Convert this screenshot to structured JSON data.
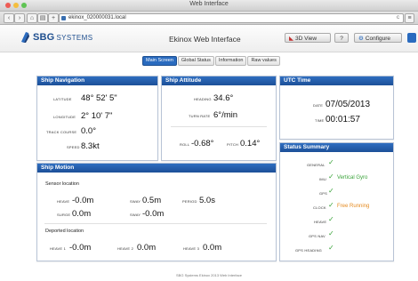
{
  "window": {
    "title": "Web Interface"
  },
  "browser": {
    "url": "ekinox_020000031.local",
    "reload": "c"
  },
  "header": {
    "brand": "SBG",
    "brand_sub": "SYSTEMS",
    "app_title": "Ekinox Web Interface",
    "btn_view": "3D View",
    "btn_help": "?",
    "btn_config": "Configure"
  },
  "tabs": [
    "Main Screen",
    "Global Status",
    "Information",
    "Raw values"
  ],
  "nav": {
    "title": "Ship Navigation",
    "latitude_label": "LATITUDE",
    "latitude": "48° 52' 5\"",
    "longitude_label": "LONGITUDE",
    "longitude": "2° 10' 7\"",
    "course_label": "TRACK COURSE",
    "course": "0.0°",
    "speed_label": "SPEED",
    "speed": "8.3kt"
  },
  "attitude": {
    "title": "Ship Attitude",
    "heading_label": "HEADING",
    "heading": "34.6°",
    "turn_label": "TURN RATE",
    "turn": "6°/min",
    "roll_label": "ROLL",
    "roll": "-0.68°",
    "pitch_label": "PITCH",
    "pitch": "0.14°"
  },
  "utc": {
    "title": "UTC Time",
    "date_label": "DATE",
    "date": "07/05/2013",
    "time_label": "TIME",
    "time": "00:01:57"
  },
  "motion": {
    "title": "Ship Motion",
    "sensor_label": "Sensor location",
    "heave_label": "HEAVE",
    "heave": "-0.0m",
    "surge_label": "SURGE",
    "surge": "0.0m",
    "sway_label": "SWAY",
    "sway": "0.5m",
    "swayv_label": "SWAY",
    "swayv": "-0.0m",
    "period_label": "PERIOD",
    "period": "5.0s",
    "deported_label": "Deported location",
    "dh1_label": "HEAVE 1",
    "dh1": "-0.0m",
    "dh2_label": "HEAVE 2",
    "dh2": "0.0m",
    "dh3_label": "HEAVE 3",
    "dh3": "0.0m"
  },
  "status": {
    "title": "Status Summary",
    "items": [
      {
        "label": "GENERAL",
        "mark": "✓",
        "text": ""
      },
      {
        "label": "IMU",
        "mark": "✓",
        "text": "Vertical Gyro"
      },
      {
        "label": "GPS",
        "mark": "✓",
        "text": ""
      },
      {
        "label": "CLOCK",
        "mark": "✓",
        "text": "Free Running"
      },
      {
        "label": "HEAVE",
        "mark": "✓",
        "text": ""
      },
      {
        "label": "GPS NAV",
        "mark": "✓",
        "text": ""
      },
      {
        "label": "GPS HEADING",
        "mark": "✓",
        "text": ""
      }
    ],
    "color_ok": "#3aa33a",
    "color_warn": "#e58a1f"
  },
  "footer": "SBG Systems Ekinox 2013 Web Interface"
}
